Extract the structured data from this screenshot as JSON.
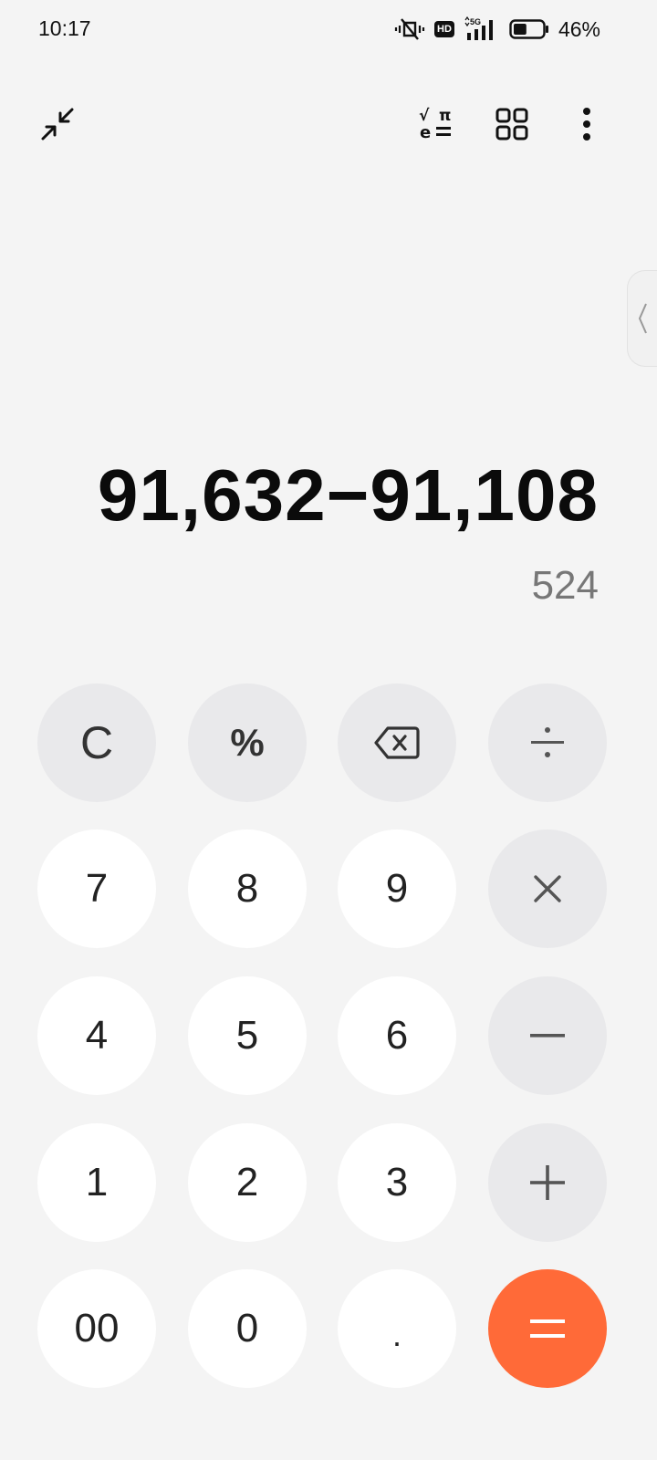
{
  "status_bar": {
    "time": "10:17",
    "hd_label": "HD",
    "network_label": "5G",
    "battery_percent": "46%",
    "battery_level": 0.46
  },
  "toolbar": {
    "collapse_icon": "collapse-arrows-icon",
    "scientific_icon": "scientific-functions-icon",
    "scientific_sqrt": "√",
    "scientific_pi": "π",
    "scientific_e": "e",
    "apps_icon": "grid-icon",
    "more_icon": "more-vertical-icon"
  },
  "display": {
    "expression": "91,632−91,108",
    "result": "524"
  },
  "keys": {
    "clear": "C",
    "percent": "%",
    "seven": "7",
    "eight": "8",
    "nine": "9",
    "four": "4",
    "five": "5",
    "six": "6",
    "one": "1",
    "two": "2",
    "three": "3",
    "double_zero": "00",
    "zero": "0",
    "decimal": "."
  },
  "colors": {
    "background": "#f4f4f4",
    "number_key": "#ffffff",
    "operator_key": "#e9e9eb",
    "equals_key": "#ff6a38"
  }
}
